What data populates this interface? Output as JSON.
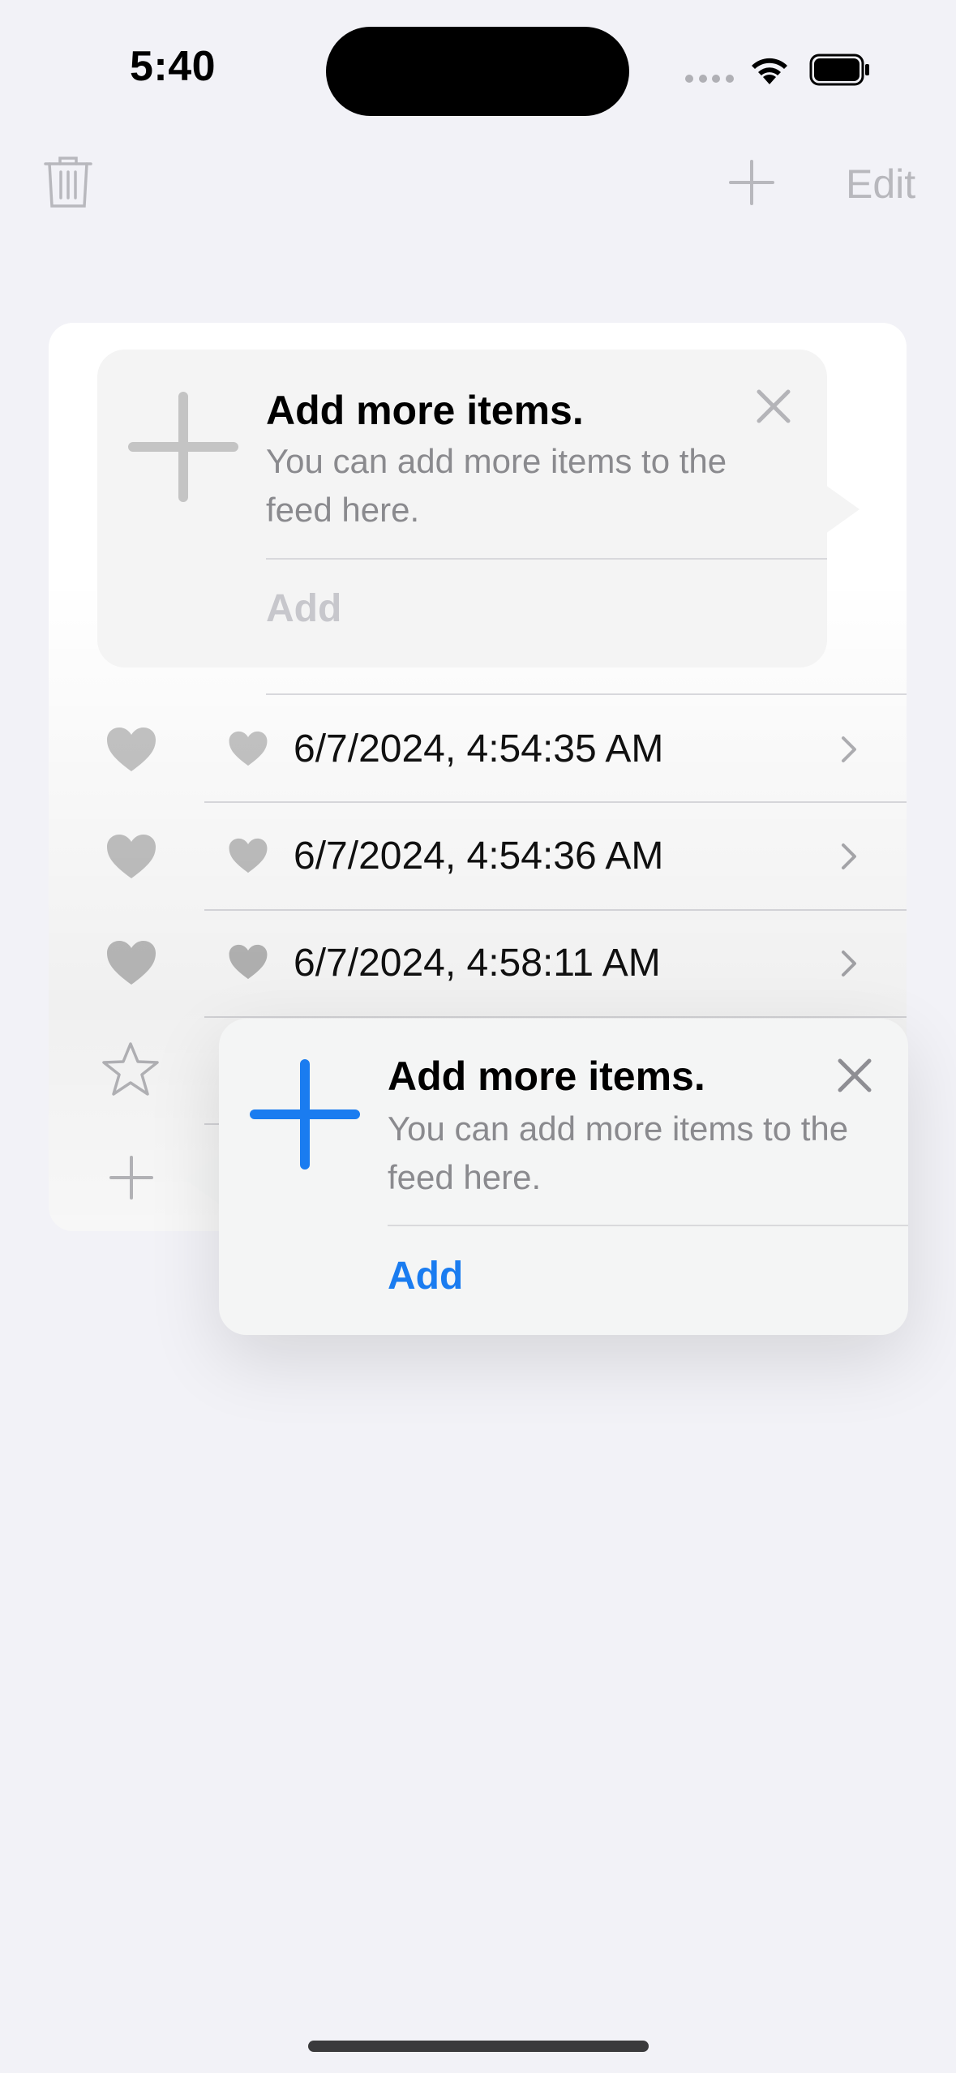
{
  "status": {
    "time": "5:40"
  },
  "toolbar": {
    "edit_label": "Edit"
  },
  "tips": [
    {
      "title": "Add more items.",
      "body": "You can add more items to the feed here.",
      "action": "Add",
      "active": false
    },
    {
      "title": "Add more items.",
      "body": "You can add more items to the feed here.",
      "action": "Add",
      "active": true
    }
  ],
  "rows": [
    {
      "timestamp": "6/7/2024, 4:54:35 AM"
    },
    {
      "timestamp": "6/7/2024, 4:54:36 AM"
    },
    {
      "timestamp": "6/7/2024, 4:58:11 AM"
    }
  ],
  "colors": {
    "accent": "#1a7cf0",
    "background": "#f2f2f7",
    "disabled": "#c7c7cc"
  }
}
